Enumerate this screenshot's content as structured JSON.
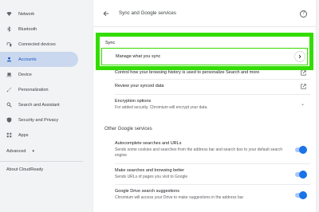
{
  "sidebar": {
    "items": [
      {
        "label": "Network",
        "icon": "wifi-icon"
      },
      {
        "label": "Bluetooth",
        "icon": "bluetooth-icon"
      },
      {
        "label": "Connected devices",
        "icon": "devices-icon"
      },
      {
        "label": "Accounts",
        "icon": "person-icon",
        "active": true
      },
      {
        "label": "Device",
        "icon": "laptop-icon"
      },
      {
        "label": "Personalization",
        "icon": "brush-icon"
      },
      {
        "label": "Search and Assistant",
        "icon": "search-icon"
      },
      {
        "label": "Security and Privacy",
        "icon": "shield-icon"
      },
      {
        "label": "Apps",
        "icon": "apps-grid-icon"
      }
    ],
    "advanced_label": "Advanced",
    "about_label": "About CloudReady"
  },
  "header": {
    "title": "Sync and Google services"
  },
  "sync": {
    "section_label": "Sync",
    "manage_label": "Manage what you sync",
    "control_label": "Control how your browsing history is used to personalize Search and more",
    "review_label": "Review your synced data",
    "encryption_title": "Encryption options",
    "encryption_sub": "For added security, Chromium will encrypt your data."
  },
  "other": {
    "section_label": "Other Google services",
    "items": [
      {
        "title": "Autocomplete searches and URLs",
        "sub": "Sends some cookies and searches from the address bar and search box to your default search engine",
        "enabled": true
      },
      {
        "title": "Make searches and browsing better",
        "sub": "Sends URLs of pages you visit to Google",
        "enabled": true
      },
      {
        "title": "Google Drive search suggestions",
        "sub": "Chromium will access your Drive to make suggestions in the address bar",
        "enabled": true
      }
    ]
  },
  "colors": {
    "highlight": "#33dd00",
    "accent": "#1a73e8",
    "active_bg": "#c9d8ee"
  }
}
